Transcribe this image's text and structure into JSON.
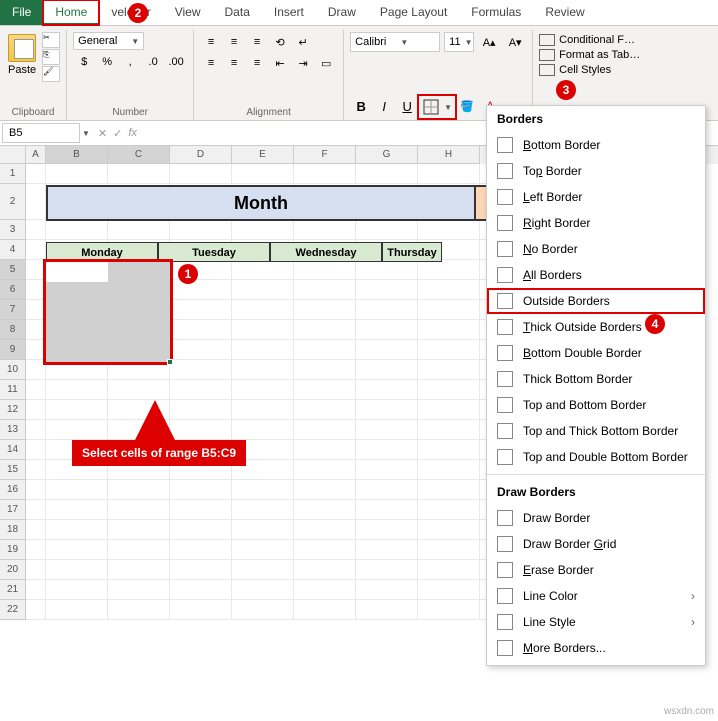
{
  "tabs": {
    "file": "File",
    "home": "Home",
    "developer": "veloper",
    "view": "View",
    "data": "Data",
    "insert": "Insert",
    "draw": "Draw",
    "pagelayout": "Page Layout",
    "formulas": "Formulas",
    "review": "Review"
  },
  "ribbon": {
    "paste": "Paste",
    "clipboard": "Clipboard",
    "number_format": "General",
    "number": "Number",
    "alignment": "Alignment",
    "font_name": "Calibri",
    "font_size": "11",
    "cond_fmt": "Conditional F…",
    "fmt_table": "Format as Tab…",
    "cell_styles": "Cell Styles"
  },
  "formula_bar": {
    "cell_ref": "B5",
    "fx": "fx"
  },
  "columns": [
    "A",
    "B",
    "C",
    "D",
    "E",
    "F",
    "G",
    "H"
  ],
  "rows_visible": 22,
  "sheet": {
    "month_label": "Month",
    "days": [
      "Monday",
      "Tuesday",
      "Wednesday",
      "Thursday"
    ]
  },
  "annotation": "Select cells of range B5:C9",
  "borders_menu": {
    "title": "Borders",
    "items1": [
      {
        "label": "Bottom Border",
        "u": "B"
      },
      {
        "label": "Top Border",
        "u": "p"
      },
      {
        "label": "Left Border",
        "u": "L"
      },
      {
        "label": "Right Border",
        "u": "R"
      },
      {
        "label": "No Border",
        "u": "N"
      },
      {
        "label": "All Borders",
        "u": "A"
      },
      {
        "label": "Outside Borders",
        "u": "S",
        "hl": true
      },
      {
        "label": "Thick Outside Borders",
        "u": "T"
      },
      {
        "label": "Bottom Double Border",
        "u": "B"
      },
      {
        "label": "Thick Bottom Border",
        "u": "H"
      },
      {
        "label": "Top and Bottom Border",
        "u": "D"
      },
      {
        "label": "Top and Thick Bottom Border",
        "u": "C"
      },
      {
        "label": "Top and Double Bottom Border",
        "u": "U"
      }
    ],
    "draw_title": "Draw Borders",
    "items2": [
      {
        "label": "Draw Border",
        "u": "W"
      },
      {
        "label": "Draw Border Grid",
        "u": "G"
      },
      {
        "label": "Erase Border",
        "u": "E"
      },
      {
        "label": "Line Color",
        "u": "I",
        "arrow": true
      },
      {
        "label": "Line Style",
        "u": "Y",
        "arrow": true
      },
      {
        "label": "More Borders...",
        "u": "M"
      }
    ]
  },
  "callouts": {
    "c1": "1",
    "c2": "2",
    "c3": "3",
    "c4": "4"
  },
  "watermark": "wsxdn.com"
}
